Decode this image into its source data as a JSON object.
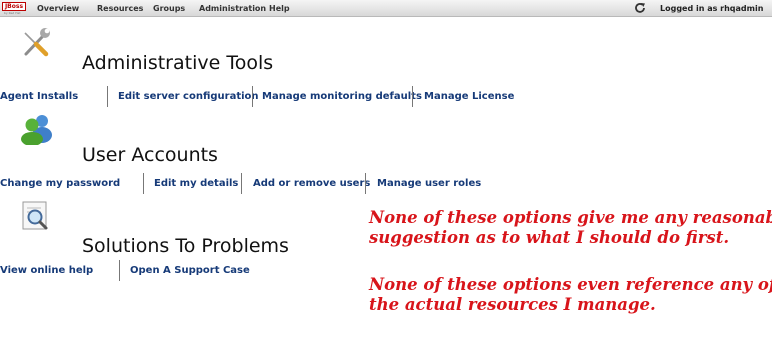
{
  "header": {
    "logo_text": "JBoss",
    "logo_sub": "by Red Hat",
    "nav": [
      "Overview",
      "Resources",
      "Groups",
      "Administration",
      "Help"
    ],
    "refresh_icon": "refresh-icon",
    "logged_in": "Logged in as rhqadmin"
  },
  "sections": [
    {
      "title": "Administrative Tools",
      "icon": "tools-icon",
      "links": [
        "Agent Installs",
        "Edit server configuration",
        "Manage monitoring defaults",
        "Manage License"
      ]
    },
    {
      "title": "User Accounts",
      "icon": "users-icon",
      "links": [
        "Change my password",
        "Edit my details",
        "Add or remove users",
        "Manage user roles"
      ]
    },
    {
      "title": "Solutions To Problems",
      "icon": "magnifier-icon",
      "links": [
        "View online help",
        "Open A Support Case"
      ]
    }
  ],
  "annotations": {
    "note1_line1": "None of these options give me any reasonable",
    "note1_line2": "suggestion as to what I should do first.",
    "note2_line1": "None of these options even reference any of",
    "note2_line2": "the actual resources I manage."
  },
  "colors": {
    "link": "#163a78",
    "annotation": "#d8141a"
  }
}
